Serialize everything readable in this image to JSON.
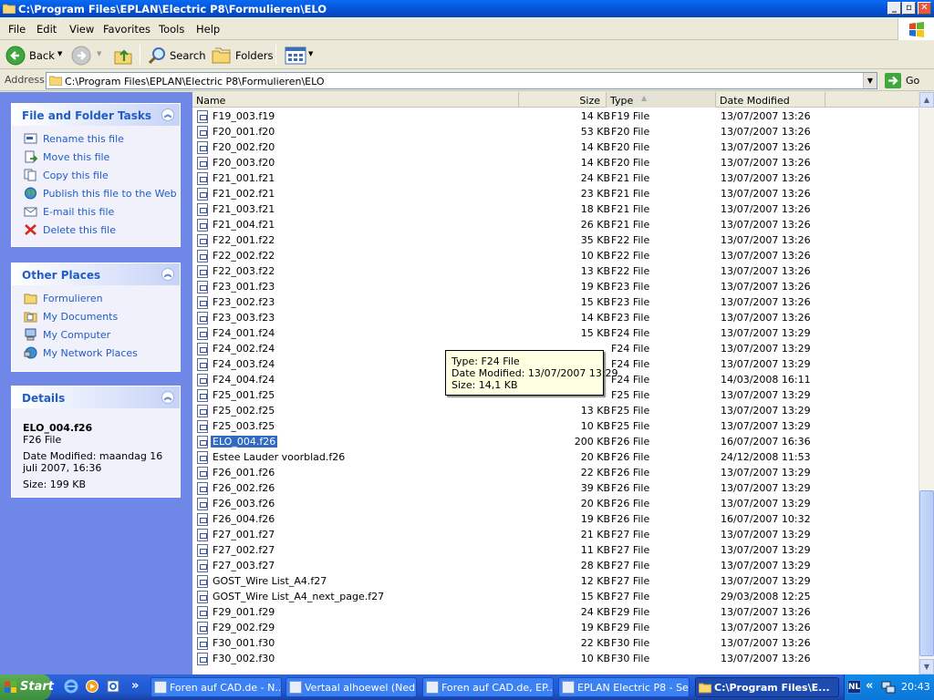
{
  "window": {
    "title": "C:\\Program Files\\EPLAN\\Electric P8\\Formulieren\\ELO"
  },
  "menu": [
    "File",
    "Edit",
    "View",
    "Favorites",
    "Tools",
    "Help"
  ],
  "toolbar": {
    "back": "Back",
    "search": "Search",
    "folders": "Folders"
  },
  "address": {
    "label": "Address",
    "value": "C:\\Program Files\\EPLAN\\Electric P8\\Formulieren\\ELO",
    "go": "Go"
  },
  "tasks_panel": {
    "title": "File and Folder Tasks",
    "items": [
      {
        "label": "Rename this file",
        "icon": "rename-icon"
      },
      {
        "label": "Move this file",
        "icon": "move-icon"
      },
      {
        "label": "Copy this file",
        "icon": "copy-icon"
      },
      {
        "label": "Publish this file to the Web",
        "icon": "globe-icon"
      },
      {
        "label": "E-mail this file",
        "icon": "email-icon"
      },
      {
        "label": "Delete this file",
        "icon": "delete-icon"
      }
    ]
  },
  "places_panel": {
    "title": "Other Places",
    "items": [
      {
        "label": "Formulieren",
        "icon": "folder-icon"
      },
      {
        "label": "My Documents",
        "icon": "my-documents-icon"
      },
      {
        "label": "My Computer",
        "icon": "my-computer-icon"
      },
      {
        "label": "My Network Places",
        "icon": "network-places-icon"
      }
    ]
  },
  "details_panel": {
    "title": "Details",
    "filename": "ELO_004.f26",
    "filetype": "F26 File",
    "modified": "Date Modified: maandag 16 juli 2007, 16:36",
    "size": "Size: 199 KB"
  },
  "columns": {
    "name": "Name",
    "size": "Size",
    "type": "Type",
    "date": "Date Modified"
  },
  "files": [
    {
      "name": "F19_003.f19",
      "size": "14 KB",
      "type": "F19 File",
      "date": "13/07/2007 13:26"
    },
    {
      "name": "F20_001.f20",
      "size": "53 KB",
      "type": "F20 File",
      "date": "13/07/2007 13:26"
    },
    {
      "name": "F20_002.f20",
      "size": "14 KB",
      "type": "F20 File",
      "date": "13/07/2007 13:26"
    },
    {
      "name": "F20_003.f20",
      "size": "14 KB",
      "type": "F20 File",
      "date": "13/07/2007 13:26"
    },
    {
      "name": "F21_001.f21",
      "size": "24 KB",
      "type": "F21 File",
      "date": "13/07/2007 13:26"
    },
    {
      "name": "F21_002.f21",
      "size": "23 KB",
      "type": "F21 File",
      "date": "13/07/2007 13:26"
    },
    {
      "name": "F21_003.f21",
      "size": "18 KB",
      "type": "F21 File",
      "date": "13/07/2007 13:26"
    },
    {
      "name": "F21_004.f21",
      "size": "26 KB",
      "type": "F21 File",
      "date": "13/07/2007 13:26"
    },
    {
      "name": "F22_001.f22",
      "size": "35 KB",
      "type": "F22 File",
      "date": "13/07/2007 13:26"
    },
    {
      "name": "F22_002.f22",
      "size": "10 KB",
      "type": "F22 File",
      "date": "13/07/2007 13:26"
    },
    {
      "name": "F22_003.f22",
      "size": "13 KB",
      "type": "F22 File",
      "date": "13/07/2007 13:26"
    },
    {
      "name": "F23_001.f23",
      "size": "19 KB",
      "type": "F23 File",
      "date": "13/07/2007 13:26"
    },
    {
      "name": "F23_002.f23",
      "size": "15 KB",
      "type": "F23 File",
      "date": "13/07/2007 13:26"
    },
    {
      "name": "F23_003.f23",
      "size": "14 KB",
      "type": "F23 File",
      "date": "13/07/2007 13:26"
    },
    {
      "name": "F24_001.f24",
      "size": "15 KB",
      "type": "F24 File",
      "date": "13/07/2007 13:29"
    },
    {
      "name": "F24_002.f24",
      "size": "",
      "type": "F24 File",
      "date": "13/07/2007 13:29"
    },
    {
      "name": "F24_003.f24",
      "size": "",
      "type": "F24 File",
      "date": "13/07/2007 13:29"
    },
    {
      "name": "F24_004.f24",
      "size": "",
      "type": "F24 File",
      "date": "14/03/2008 16:11"
    },
    {
      "name": "F25_001.f25",
      "size": "",
      "type": "F25 File",
      "date": "13/07/2007 13:29"
    },
    {
      "name": "F25_002.f25",
      "size": "13 KB",
      "type": "F25 File",
      "date": "13/07/2007 13:29"
    },
    {
      "name": "F25_003.f25",
      "size": "10 KB",
      "type": "F25 File",
      "date": "13/07/2007 13:29"
    },
    {
      "name": "ELO_004.f26",
      "size": "200 KB",
      "type": "F26 File",
      "date": "16/07/2007 16:36",
      "selected": true
    },
    {
      "name": "Estee Lauder voorblad.f26",
      "size": "20 KB",
      "type": "F26 File",
      "date": "24/12/2008 11:53"
    },
    {
      "name": "F26_001.f26",
      "size": "22 KB",
      "type": "F26 File",
      "date": "13/07/2007 13:29"
    },
    {
      "name": "F26_002.f26",
      "size": "39 KB",
      "type": "F26 File",
      "date": "13/07/2007 13:29"
    },
    {
      "name": "F26_003.f26",
      "size": "20 KB",
      "type": "F26 File",
      "date": "13/07/2007 13:29"
    },
    {
      "name": "F26_004.f26",
      "size": "19 KB",
      "type": "F26 File",
      "date": "16/07/2007 10:32"
    },
    {
      "name": "F27_001.f27",
      "size": "21 KB",
      "type": "F27 File",
      "date": "13/07/2007 13:29"
    },
    {
      "name": "F27_002.f27",
      "size": "11 KB",
      "type": "F27 File",
      "date": "13/07/2007 13:29"
    },
    {
      "name": "F27_003.f27",
      "size": "28 KB",
      "type": "F27 File",
      "date": "13/07/2007 13:29"
    },
    {
      "name": "GOST_Wire List_A4.f27",
      "size": "12 KB",
      "type": "F27 File",
      "date": "13/07/2007 13:29"
    },
    {
      "name": "GOST_Wire List_A4_next_page.f27",
      "size": "15 KB",
      "type": "F27 File",
      "date": "29/03/2008 12:25"
    },
    {
      "name": "F29_001.f29",
      "size": "24 KB",
      "type": "F29 File",
      "date": "13/07/2007 13:26"
    },
    {
      "name": "F29_002.f29",
      "size": "19 KB",
      "type": "F29 File",
      "date": "13/07/2007 13:26"
    },
    {
      "name": "F30_001.f30",
      "size": "22 KB",
      "type": "F30 File",
      "date": "13/07/2007 13:26"
    },
    {
      "name": "F30_002.f30",
      "size": "10 KB",
      "type": "F30 File",
      "date": "13/07/2007 13:26"
    }
  ],
  "tooltip": {
    "type": "Type: F24 File",
    "date": "Date Modified: 13/07/2007 13:29",
    "size": "Size: 14,1 KB"
  },
  "taskbar": {
    "start": "Start",
    "tasks": [
      {
        "label": "Foren auf CAD.de - N..."
      },
      {
        "label": "Vertaal alhoewel (Ned..."
      },
      {
        "label": "Foren auf CAD.de, EP..."
      },
      {
        "label": "EPLAN Electric P8 - Se..."
      },
      {
        "label": "C:\\Program Files\\E...",
        "active": true
      }
    ],
    "lang": "NL",
    "clock": "20:43",
    "more": "»",
    "tray_arrow": "«"
  },
  "colors": {
    "title_blue": "#0a58e0",
    "task_pane_blue": "#6f87e6",
    "selection": "#316ac5",
    "tooltip_bg": "#ffffe1",
    "taskbar_blue": "#245edb",
    "start_green": "#3c8f3c"
  }
}
